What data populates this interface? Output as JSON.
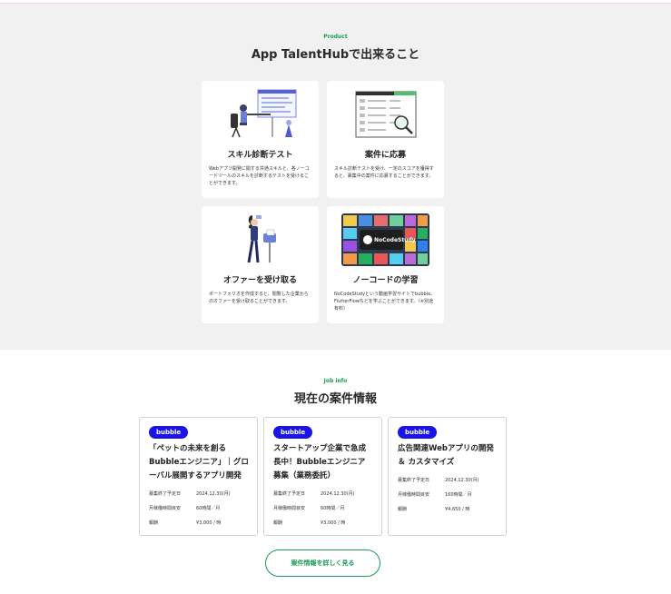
{
  "product": {
    "eyebrow": "Product",
    "title": "App TalentHubで出来ること",
    "features": [
      {
        "title": "スキル診断テスト",
        "desc": "Webアプリ開発に関する共通スキルと、各ノーコードツールのスキルを診断するテストを受けることができます。",
        "icon": "person-at-board-illustration"
      },
      {
        "title": "案件に応募",
        "desc": "スキル診断テストを受け、一定のスコアを獲得すると、募集中の案件に応募することができます。",
        "icon": "job-list-magnifier-illustration"
      },
      {
        "title": "オファーを受け取る",
        "desc": "ポートフォリオを作成すると、閲覧した企業からのオファーを受け取ることができます。",
        "icon": "person-mailbox-illustration"
      },
      {
        "title": "ノーコードの学習",
        "desc": "NoCodeStudyという動画学習サイトでbubble、FlutterFlowなどを学ぶことができます。（※別途有料）",
        "icon": "nocodestudy-collage-image",
        "logo_text": "NoCodeStudy"
      }
    ]
  },
  "jobs": {
    "eyebrow": "Job info",
    "title": "現在の案件情報",
    "row_labels": {
      "deadline": "募集終了予定日",
      "hours": "月稼働時間目安",
      "pay": "報酬"
    },
    "cards": [
      {
        "badge": "bubble",
        "title_lines": [
          "「ペットの未来を創る",
          "Bubbleエンジニア」｜グロ",
          "ーバル展開するアプリ開発"
        ],
        "deadline": "2024.12.30(月)",
        "hours": "60時間／月",
        "pay": "¥3,000 / 時"
      },
      {
        "badge": "bubble",
        "title_lines": [
          "スタートアップ企業で急成",
          "長中！Bubbleエンジニア",
          "募集（業務委託）"
        ],
        "deadline": "2024.12.30(月)",
        "hours": "60時間／月",
        "pay": "¥3,000 / 時"
      },
      {
        "badge": "bubble",
        "title_lines": [
          "広告関連Webアプリの開発",
          "＆ カスタマイズ"
        ],
        "deadline": "2024.12.30(月)",
        "hours": "160時間／月",
        "pay": "¥4,650 / 時"
      }
    ],
    "more_label": "案件情報を詳しく見る"
  },
  "colors": {
    "accent_green": "#1a9b56",
    "badge_blue": "#1a14e6",
    "section_bg": "#f1f1f1"
  }
}
